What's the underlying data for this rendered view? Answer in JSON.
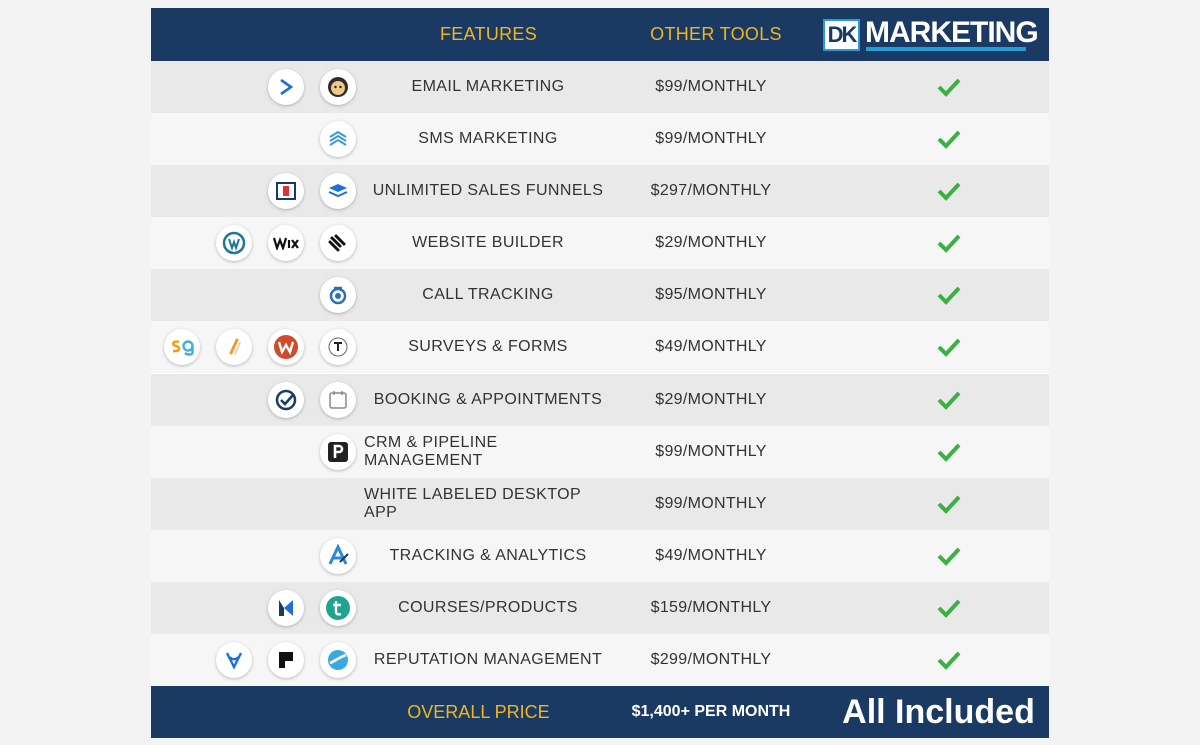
{
  "header": {
    "features_label": "FEATURES",
    "other_tools_label": "OTHER TOOLS",
    "brand": {
      "mark": "DK",
      "word": "MARKETING"
    }
  },
  "rows": [
    {
      "feature": "EMAIL MARKETING",
      "price": "$99/MONTHLY",
      "included": true,
      "icons": [
        "activecampaign-icon",
        "mailchimp-icon"
      ]
    },
    {
      "feature": "SMS MARKETING",
      "price": "$99/MONTHLY",
      "included": true,
      "icons": [
        "sms-layers-icon"
      ]
    },
    {
      "feature": "UNLIMITED SALES FUNNELS",
      "price": "$297/MONTHLY",
      "included": true,
      "icons": [
        "clickfunnels-icon",
        "leadpages-icon"
      ]
    },
    {
      "feature": "WEBSITE BUILDER",
      "price": "$29/MONTHLY",
      "included": true,
      "icons": [
        "wordpress-icon",
        "wix-icon",
        "squarespace-icon"
      ]
    },
    {
      "feature": "CALL TRACKING",
      "price": "$95/MONTHLY",
      "included": true,
      "icons": [
        "callrail-icon"
      ]
    },
    {
      "feature": "SURVEYS & FORMS",
      "price": "$49/MONTHLY",
      "included": true,
      "icons": [
        "surveygizmo-icon",
        "jotform-icon",
        "wufoo-icon",
        "typeform-icon"
      ]
    },
    {
      "feature": "BOOKING & APPOINTMENTS",
      "price": "$29/MONTHLY",
      "included": true,
      "icons": [
        "acuity-icon",
        "calendly-icon"
      ]
    },
    {
      "feature": "CRM & PIPELINE MANAGEMENT",
      "price": "$99/MONTHLY",
      "included": true,
      "icons": [
        "pipedrive-icon"
      ]
    },
    {
      "feature": "WHITE LABELED DESKTOP APP",
      "price": "$99/MONTHLY",
      "included": true,
      "icons": []
    },
    {
      "feature": "TRACKING & ANALYTICS",
      "price": "$49/MONTHLY",
      "included": true,
      "icons": [
        "analytics-icon"
      ]
    },
    {
      "feature": "COURSES/PRODUCTS",
      "price": "$159/MONTHLY",
      "included": true,
      "icons": [
        "kajabi-icon",
        "teachable-icon"
      ]
    },
    {
      "feature": "REPUTATION MANAGEMENT",
      "price": "$299/MONTHLY",
      "included": true,
      "icons": [
        "birdeye-icon",
        "podium-icon",
        "reputation-icon"
      ]
    }
  ],
  "footer": {
    "overall_label": "OVERALL PRICE",
    "overall_price": "$1,400+ PER MONTH",
    "included_label": "All Included"
  },
  "colors": {
    "navy": "#1a3a63",
    "gold": "#f3b51d",
    "check_green": "#3cb043"
  }
}
